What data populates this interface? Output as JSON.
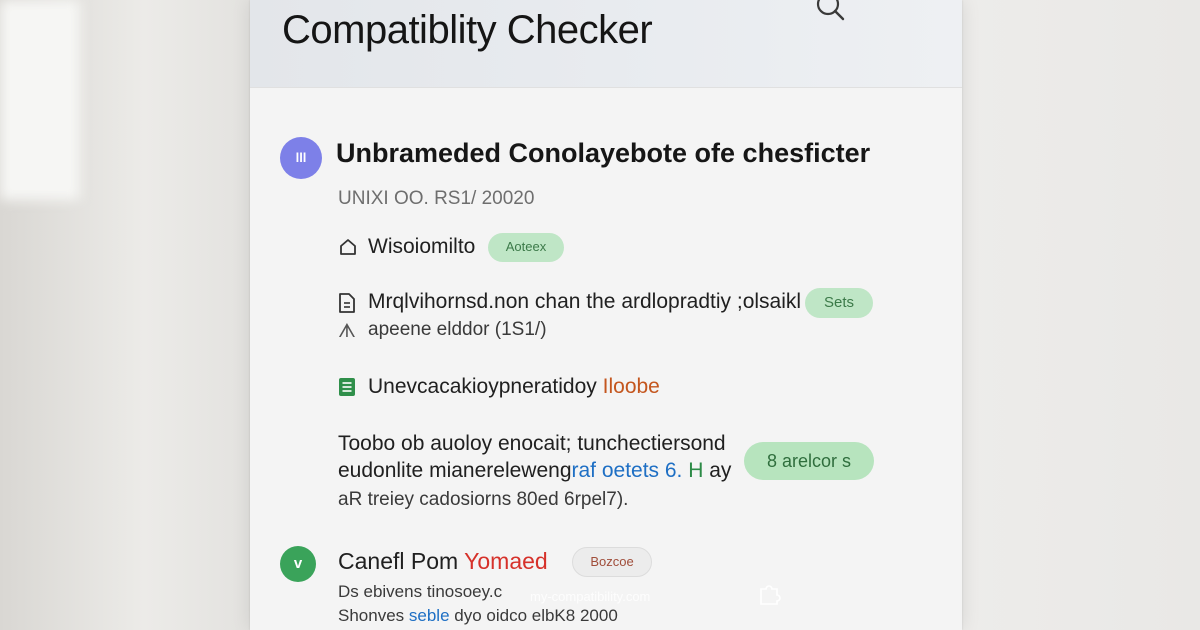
{
  "header": {
    "title": "Compatiblity Checker",
    "search_icon": "search-icon"
  },
  "item": {
    "avatar_label": "lll",
    "title": "Unbrameded Conolayebote ofe chesficter",
    "meta": "UNIXI OO. RS1/ 20020"
  },
  "rows": [
    {
      "icon": "home-icon",
      "label": "Wisoiomilto",
      "badge": "Aoteex"
    },
    {
      "icon": "document-icon",
      "label": "Mrqlvihornsd.non chan the ardlopradtiy ;olsaikl",
      "badge": "Sets",
      "sub": "apeene elddor (1S1/)",
      "sub_marker": "ᗑ"
    },
    {
      "icon": "list-icon",
      "label": "Unevcacakioypneratidoy",
      "accent": "Iloobe"
    }
  ],
  "paragraph": {
    "line1": "Toobo ob auoloy enocait; tunchectiersond",
    "line2_a": "eudonlite mianereleweng",
    "line2_b": "raf oetets 6. ",
    "line2_c": "H",
    "line2_d": " ay",
    "line3": "aR treiey cadosiorns 80ed 6rpel7).",
    "badge": "8 arelcor s"
  },
  "footer_item": {
    "badge_label": "v",
    "title_a": "Canefl Pom",
    "title_b": "Yomaed",
    "badge": "Bozcoe",
    "line1": "Ds ebivens tinosoey.c",
    "line2_a": "Shonves ",
    "line2_b": "seble",
    "line2_c": " dyo oidco elbK8 2000"
  },
  "watermark": "my-compatibility.com",
  "colors": {
    "accent_purple": "#7d80e8",
    "badge_green": "#bfe6c6",
    "orange_text": "#c4561e",
    "red_text": "#d6312a"
  }
}
